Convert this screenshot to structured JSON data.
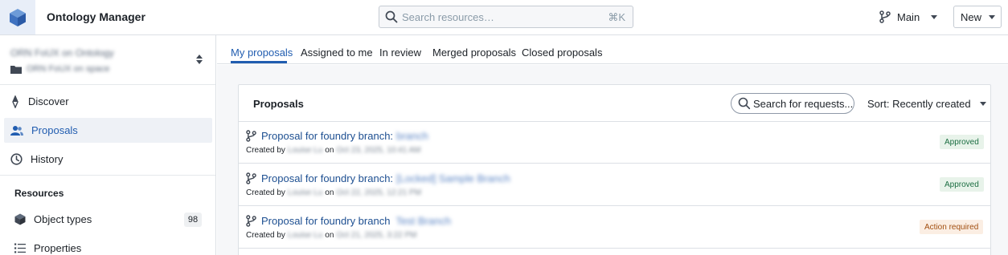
{
  "app": {
    "title": "Ontology Manager",
    "logo_icon": "cube-icon"
  },
  "search": {
    "placeholder": "Search resources…",
    "shortcut": "⌘K"
  },
  "header": {
    "branch_label": "Main",
    "new_label": "New"
  },
  "sidebar": {
    "context_name": "ORN FoUX on Ontology",
    "context_space": "ORN FoUX on space",
    "items": [
      {
        "label": "Discover",
        "icon": "compass-icon"
      },
      {
        "label": "Proposals",
        "icon": "people-icon"
      },
      {
        "label": "History",
        "icon": "clock-icon"
      }
    ],
    "resources_label": "Resources",
    "resources": [
      {
        "label": "Object types",
        "icon": "cube-icon",
        "count": "98"
      },
      {
        "label": "Properties",
        "icon": "list-icon"
      }
    ]
  },
  "tabs": [
    {
      "label": "My proposals"
    },
    {
      "label": "Assigned to me"
    },
    {
      "label": "In review"
    },
    {
      "label": "Merged proposals"
    },
    {
      "label": "Closed proposals"
    }
  ],
  "panel": {
    "title": "Proposals",
    "search_placeholder": "Search for requests...",
    "sort_label": "Sort: Recently created"
  },
  "proposals": [
    {
      "title": "Proposal for foundry branch:",
      "branch": "branch",
      "created_by": "Created by",
      "author": "Louise Lu",
      "on": "on",
      "date": "Oct 23, 2025, 10:41 AM",
      "status": "Approved"
    },
    {
      "title": "Proposal for foundry branch:",
      "branch": "[Locked] Sample Branch",
      "created_by": "Created by",
      "author": "Louise Lu",
      "on": "on",
      "date": "Oct 22, 2025, 12:21 PM",
      "status": "Approved"
    },
    {
      "title": "Proposal for foundry branch",
      "branch": "Test Branch",
      "created_by": "Created by",
      "author": "Louise Lu",
      "on": "on",
      "date": "Oct 21, 2025, 3:22 PM",
      "status": "Action required"
    }
  ],
  "colors": {
    "accent": "#215db0",
    "link": "#1d4f91",
    "approved_bg": "#e8f3ea",
    "approved_text": "#1c6e42",
    "action_bg": "#fbeee3",
    "action_text": "#a14e10"
  }
}
